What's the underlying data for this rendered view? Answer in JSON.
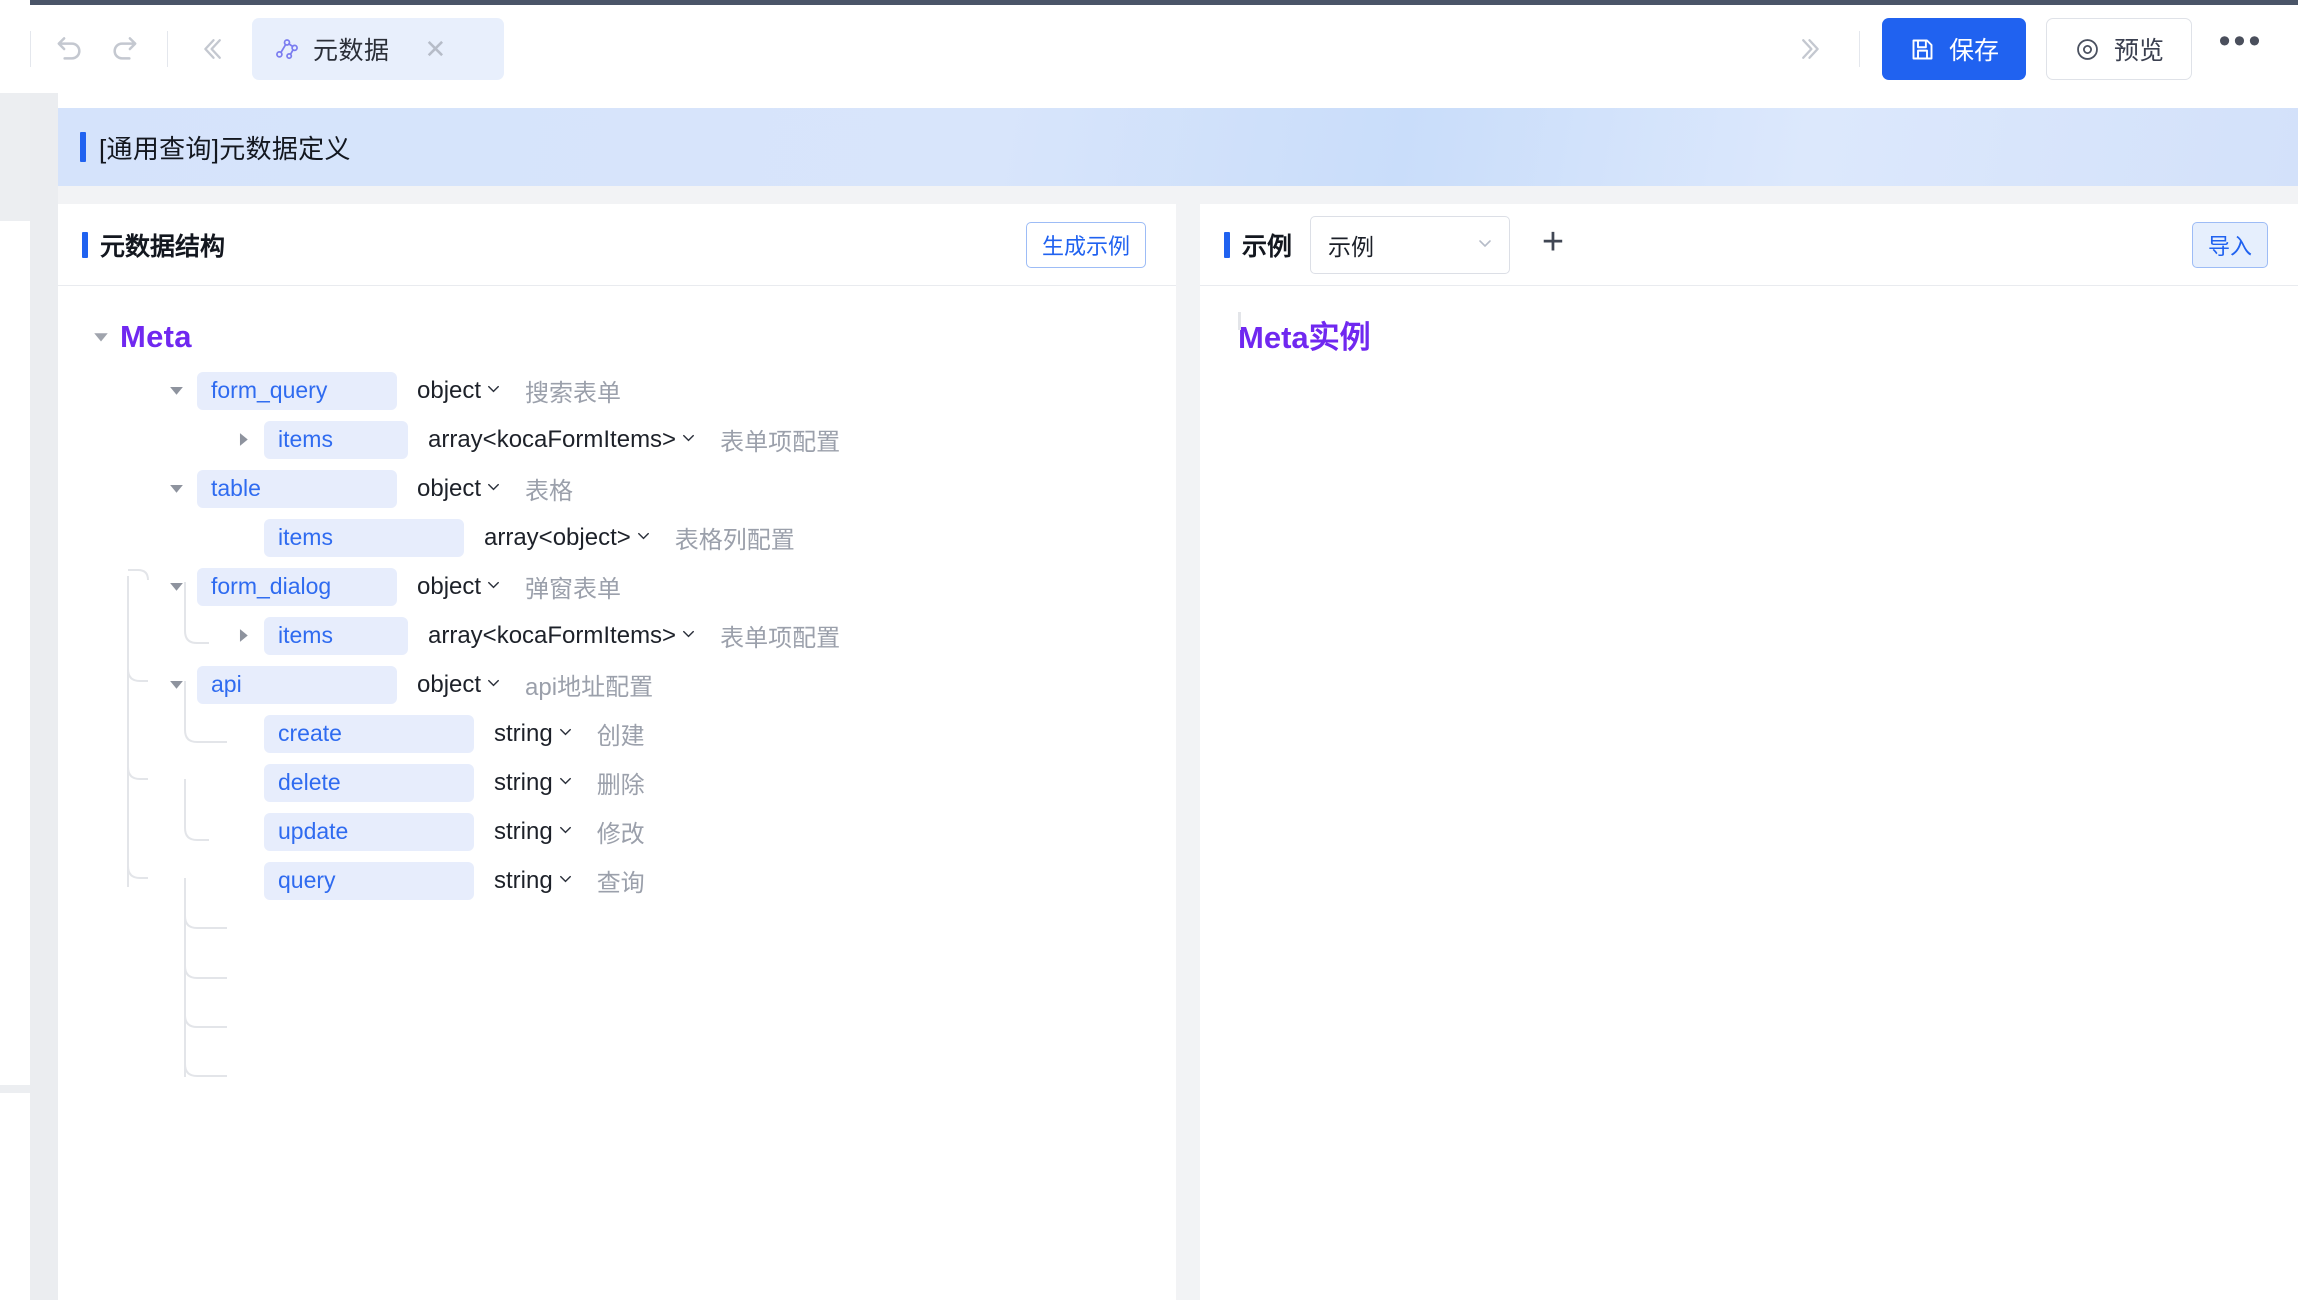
{
  "toolbar": {
    "undo_label": "undo",
    "redo_label": "redo",
    "collapse_left_label": "«",
    "collapse_right_label": "»",
    "tab": {
      "label": "元数据",
      "icon": "node-graph-icon",
      "close": "✕"
    },
    "save_label": "保存",
    "preview_label": "预览",
    "more_label": "•••"
  },
  "banner": {
    "title": "[通用查询]元数据定义"
  },
  "left_pane": {
    "title": "元数据结构",
    "generate_label": "生成示例",
    "root": {
      "label": "Meta",
      "expanded": true
    },
    "nodes": [
      {
        "name": "form_query",
        "type": "object",
        "desc": "搜索表单",
        "depth": 1,
        "caret": "down",
        "chip_w": 200
      },
      {
        "name": "items",
        "type": "array<kocaFormItems>",
        "desc": "表单项配置",
        "depth": 2,
        "caret": "right",
        "chip_w": 144
      },
      {
        "name": "table",
        "type": "object",
        "desc": "表格",
        "depth": 1,
        "caret": "down",
        "chip_w": 200
      },
      {
        "name": "items",
        "type": "array<object>",
        "desc": "表格列配置",
        "depth": 2,
        "caret": "none",
        "chip_w": 200
      },
      {
        "name": "form_dialog",
        "type": "object",
        "desc": "弹窗表单",
        "depth": 1,
        "caret": "down",
        "chip_w": 200
      },
      {
        "name": "items",
        "type": "array<kocaFormItems>",
        "desc": "表单项配置",
        "depth": 2,
        "caret": "right",
        "chip_w": 144
      },
      {
        "name": "api",
        "type": "object",
        "desc": "api地址配置",
        "depth": 1,
        "caret": "down",
        "chip_w": 200
      },
      {
        "name": "create",
        "type": "string",
        "desc": "创建",
        "depth": 2,
        "caret": "none",
        "chip_w": 210
      },
      {
        "name": "delete",
        "type": "string",
        "desc": "删除",
        "depth": 2,
        "caret": "none",
        "chip_w": 210
      },
      {
        "name": "update",
        "type": "string",
        "desc": "修改",
        "depth": 2,
        "caret": "none",
        "chip_w": 210
      },
      {
        "name": "query",
        "type": "string",
        "desc": "查询",
        "depth": 2,
        "caret": "none",
        "chip_w": 210
      }
    ]
  },
  "right_pane": {
    "title": "示例",
    "select_value": "示例",
    "select_caret": "⌄",
    "add_label": "+",
    "import_label": "导入",
    "instance_title": "Meta实例"
  },
  "colors": {
    "accent": "#2062f0",
    "chip_bg": "#e7edfc",
    "chip_text": "#2f6bf0",
    "root_purple": "#7028f0",
    "banner_blue": "#d5e3fb"
  }
}
